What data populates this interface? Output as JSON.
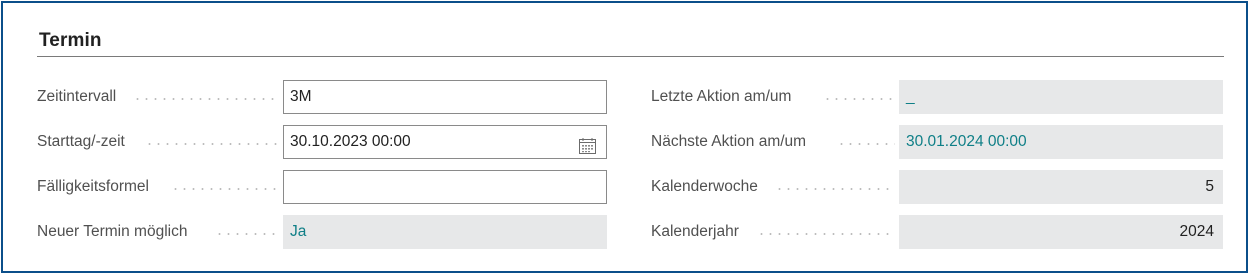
{
  "section": {
    "title": "Termin"
  },
  "left_fields": [
    {
      "label": "Zeitintervall",
      "value": "3M",
      "kind": "input"
    },
    {
      "label": "Starttag/-zeit",
      "value": "30.10.2023 00:00",
      "kind": "input-date",
      "icon": "calendar-icon"
    },
    {
      "label": "Fälligkeitsformel",
      "value": "",
      "kind": "input"
    },
    {
      "label": "Neuer Termin möglich",
      "value": "Ja",
      "kind": "readonly-link"
    }
  ],
  "right_fields": [
    {
      "label": "Letzte Aktion am/um",
      "value": "_",
      "kind": "readonly-link"
    },
    {
      "label": "Nächste Aktion am/um",
      "value": "30.01.2024 00:00",
      "kind": "readonly-link"
    },
    {
      "label": "Kalenderwoche",
      "value": "5",
      "kind": "readonly-number"
    },
    {
      "label": "Kalenderjahr",
      "value": "2024",
      "kind": "readonly-number"
    }
  ],
  "colors": {
    "frame_border": "#0b4f8a",
    "link_text": "#0f7f87",
    "readonly_bg": "#e7e8e9",
    "label_text": "#505050"
  }
}
